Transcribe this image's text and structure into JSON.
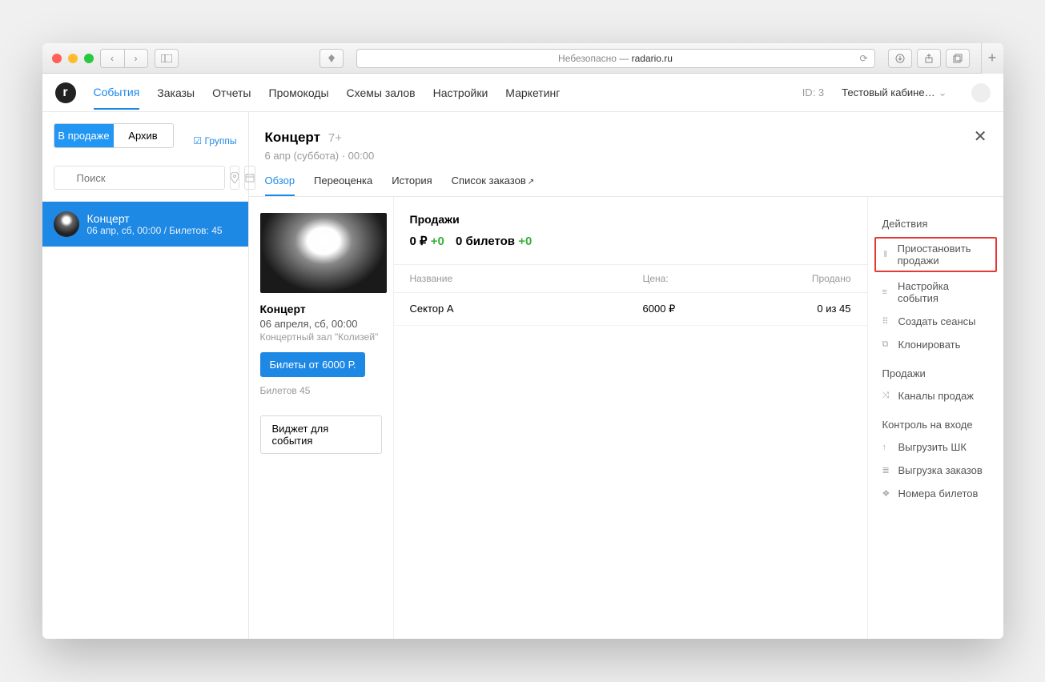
{
  "browser": {
    "address_prefix": "Небезопасно — ",
    "address": "radario.ru"
  },
  "nav": {
    "items": [
      "События",
      "Заказы",
      "Отчеты",
      "Промокоды",
      "Схемы залов",
      "Настройки",
      "Маркетинг"
    ],
    "id_label": "ID: 3",
    "account": "Тестовый кабине…"
  },
  "sidebar": {
    "tab_on_sale": "В продаже",
    "tab_archive": "Архив",
    "groups": "Группы",
    "search_placeholder": "Поиск",
    "event": {
      "title": "Концерт",
      "meta": "06 апр, сб, 00:00 / Билетов: 45"
    }
  },
  "header": {
    "title": "Концерт",
    "age": "7+",
    "subtitle": "6 апр (суббота) · 00:00",
    "tabs": {
      "overview": "Обзор",
      "reprice": "Переоценка",
      "history": "История",
      "orders": "Список заказов"
    }
  },
  "detail": {
    "title": "Концерт",
    "date": "06 апреля, сб, 00:00",
    "venue": "Концертный зал \"Колизей\"",
    "button": "Билеты от 6000 Р.",
    "tickets": "Билетов 45",
    "widget_btn": "Виджет для события"
  },
  "sales": {
    "title": "Продажи",
    "amount": "0 ₽",
    "amount_delta": "+0",
    "tickets": "0 билетов",
    "tickets_delta": "+0",
    "th_name": "Название",
    "th_price": "Цена:",
    "th_sold": "Продано",
    "rows": [
      {
        "name": "Сектор А",
        "price": "6000 ₽",
        "sold": "0 из 45"
      }
    ]
  },
  "actions": {
    "section_actions": "Действия",
    "pause": "Приостановить продажи",
    "settings": "Настройка события",
    "sessions": "Создать сеансы",
    "clone": "Клонировать",
    "section_sales": "Продажи",
    "channels": "Каналы продаж",
    "section_control": "Контроль на входе",
    "barcode": "Выгрузить ШК",
    "orders": "Выгрузка заказов",
    "numbers": "Номера билетов"
  }
}
